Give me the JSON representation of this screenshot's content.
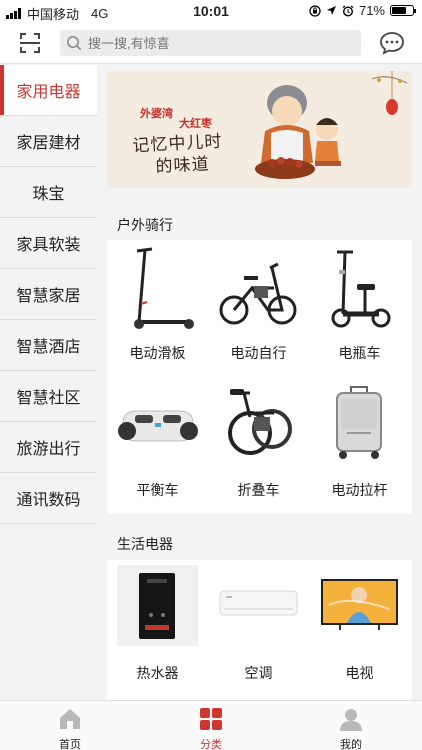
{
  "status_bar": {
    "carrier": "中国移动",
    "network": "4G",
    "time": "10:01",
    "battery_percent": "71%",
    "battery_level": 0.71
  },
  "header": {
    "search_placeholder": "搜一搜,有惊喜",
    "scan_icon": "scan-icon",
    "message_icon": "message-icon"
  },
  "sidebar": {
    "items": [
      {
        "label": "家用电器",
        "active": true
      },
      {
        "label": "家居建材",
        "active": false
      },
      {
        "label": "珠宝",
        "active": false
      },
      {
        "label": "家具软装",
        "active": false
      },
      {
        "label": "智慧家居",
        "active": false
      },
      {
        "label": "智慧酒店",
        "active": false
      },
      {
        "label": "智慧社区",
        "active": false
      },
      {
        "label": "旅游出行",
        "active": false
      },
      {
        "label": "通讯数码",
        "active": false
      }
    ]
  },
  "banner": {
    "badge_top": "外婆湾",
    "badge_sub": "大红枣",
    "line1": "记忆中儿时",
    "line2": "的味道"
  },
  "sections": [
    {
      "title": "户外骑行",
      "items": [
        {
          "label": "电动滑板",
          "icon": "scooter-icon"
        },
        {
          "label": "电动自行",
          "icon": "ebike-icon"
        },
        {
          "label": "电瓶车",
          "icon": "seated-scooter-icon"
        },
        {
          "label": "平衡车",
          "icon": "hoverboard-icon"
        },
        {
          "label": "折叠车",
          "icon": "folding-bike-icon"
        },
        {
          "label": "电动拉杆",
          "icon": "luggage-icon"
        }
      ]
    },
    {
      "title": "生活电器",
      "items": [
        {
          "label": "热水器",
          "icon": "water-heater-icon"
        },
        {
          "label": "空调",
          "icon": "air-conditioner-icon"
        },
        {
          "label": "电视",
          "icon": "tv-icon"
        }
      ]
    }
  ],
  "tabbar": {
    "items": [
      {
        "label": "首页",
        "icon": "home-icon",
        "active": false
      },
      {
        "label": "分类",
        "icon": "category-icon",
        "active": true
      },
      {
        "label": "我的",
        "icon": "profile-icon",
        "active": false
      }
    ]
  },
  "colors": {
    "accent": "#d0352f",
    "background": "#f3f3f3"
  }
}
